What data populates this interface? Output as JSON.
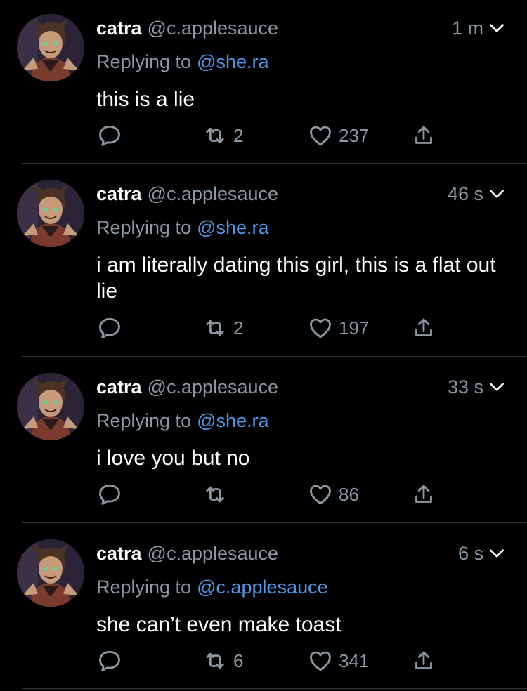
{
  "colors": {
    "background": "#000000",
    "secondary": "#8b98a5",
    "link": "#4c97e8",
    "divider": "#2f3336"
  },
  "icons": {
    "reply": "comment-icon",
    "retweet": "retweet-icon",
    "like": "heart-icon",
    "share": "share-icon",
    "menu": "chevron-down-icon"
  },
  "tweets": [
    {
      "name": "catra",
      "handle": "@c.applesauce",
      "time": "1 m",
      "reply_label": "Replying to",
      "reply_to": "@she.ra",
      "text": "this is a lie",
      "retweets": "2",
      "likes": "237"
    },
    {
      "name": "catra",
      "handle": "@c.applesauce",
      "time": "46 s",
      "reply_label": "Replying to",
      "reply_to": "@she.ra",
      "text": "i am literally dating this girl, this is a flat out lie",
      "retweets": "2",
      "likes": "197"
    },
    {
      "name": "catra",
      "handle": "@c.applesauce",
      "time": "33 s",
      "reply_label": "Replying to",
      "reply_to": "@she.ra",
      "text": "i love you but no",
      "retweets": "",
      "likes": "86"
    },
    {
      "name": "catra",
      "handle": "@c.applesauce",
      "time": "6 s",
      "reply_label": "Replying to",
      "reply_to": "@c.applesauce",
      "text": "she can’t even make toast",
      "retweets": "6",
      "likes": "341"
    }
  ]
}
